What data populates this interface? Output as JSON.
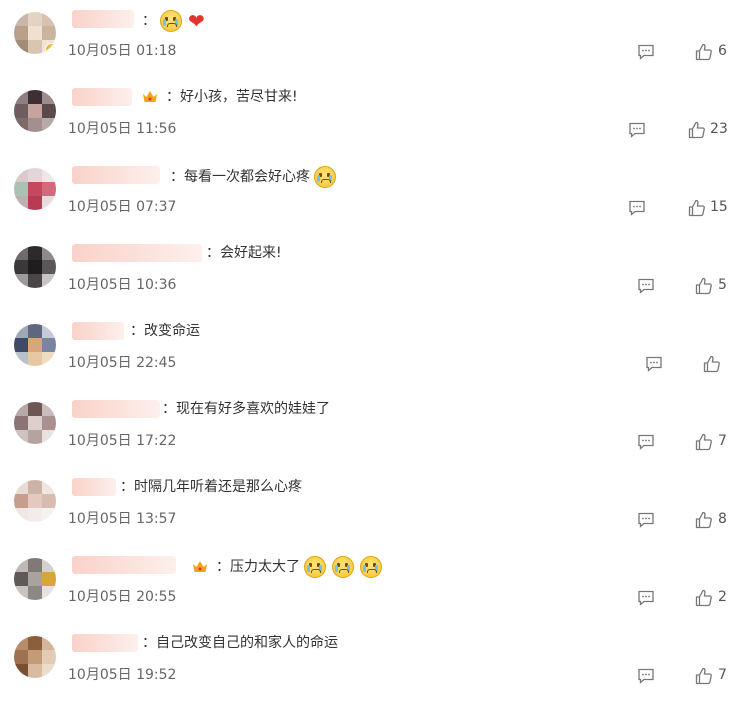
{
  "comments": [
    {
      "content": "",
      "emojis": [
        "cry-face",
        "red-heart"
      ],
      "time": "10月05日 01:18",
      "likes": "6"
    },
    {
      "content": "好小孩，苦尽甘来!",
      "emojis": [],
      "vip_crown": true,
      "time": "10月05日 11:56",
      "likes": "23"
    },
    {
      "content": "每看一次都会好心疼",
      "emojis": [
        "cry-face"
      ],
      "time": "10月05日 07:37",
      "likes": "15"
    },
    {
      "content": "会好起来!",
      "emojis": [],
      "time": "10月05日 10:36",
      "likes": "5"
    },
    {
      "content": "改变命运",
      "emojis": [],
      "time": "10月05日 22:45",
      "likes": ""
    },
    {
      "content": "现在有好多喜欢的娃娃了",
      "emojis": [],
      "time": "10月05日 17:22",
      "likes": "7"
    },
    {
      "content": "时隔几年听着还是那么心疼",
      "emojis": [],
      "time": "10月05日 13:57",
      "likes": "8"
    },
    {
      "content": "压力太大了",
      "emojis": [
        "cry-face",
        "cry-face",
        "cry-face"
      ],
      "vip_crown": true,
      "time": "10月05日 20:55",
      "likes": "2"
    },
    {
      "content": "自己改变自己的和家人的命运",
      "emojis": [],
      "time": "10月05日 19:52",
      "likes": "7"
    }
  ],
  "colors": {
    "heart": "#e5322d",
    "name_blur": "#f9d2c9",
    "vip_crown": "#f3a21b"
  },
  "icons": {
    "reply": "comment-bubble-icon",
    "like": "thumbs-up-icon"
  }
}
